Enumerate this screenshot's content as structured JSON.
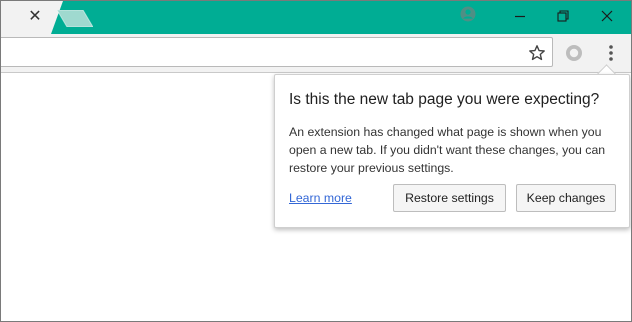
{
  "tabs": {
    "close_glyph": "✕"
  },
  "colors": {
    "titlebar": "#00ad94",
    "link": "#3367d6"
  },
  "icons": [
    "close-icon",
    "new-tab-icon",
    "profile-icon",
    "minimize-icon",
    "restore-icon",
    "close-window-icon",
    "star-icon",
    "extension-icon",
    "menu-icon"
  ],
  "dialog": {
    "title": "Is this the new tab page you were expecting?",
    "body": "An extension has changed what page is shown when you open a new tab. If you didn't want these changes, you can restore your previous settings.",
    "learn_more": "Learn more",
    "restore_button": "Restore settings",
    "keep_button": "Keep changes"
  }
}
